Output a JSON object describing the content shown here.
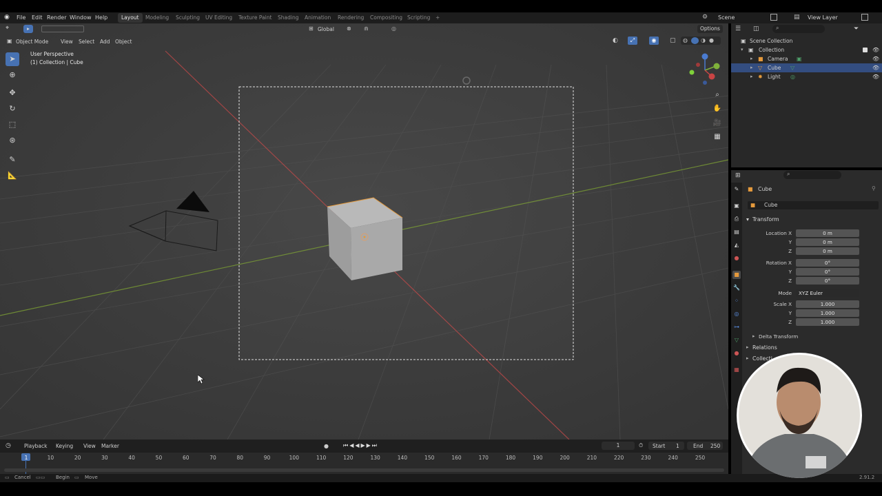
{
  "menu": {
    "items": [
      "File",
      "Edit",
      "Render",
      "Window",
      "Help"
    ],
    "workspaces": [
      "Layout",
      "Modeling",
      "Sculpting",
      "UV Editing",
      "Texture Paint",
      "Shading",
      "Animation",
      "Rendering",
      "Compositing",
      "Scripting"
    ],
    "active_workspace": "Layout",
    "scene": "Scene",
    "view_layer": "View Layer",
    "add_tab": "+"
  },
  "viewport": {
    "mode": "Object Mode",
    "menus": [
      "View",
      "Select",
      "Add",
      "Object"
    ],
    "transform_orientation": "Global",
    "options": "Options",
    "info_line1": "User Perspective",
    "info_line2": "(1) Collection | Cube"
  },
  "outliner": {
    "root": "Scene Collection",
    "collection": "Collection",
    "items": [
      "Camera",
      "Cube",
      "Light"
    ]
  },
  "properties": {
    "object_name": "Cube",
    "datablock_name": "Cube",
    "transform_header": "Transform",
    "location_label": "Location X",
    "rotation_label": "Rotation X",
    "scale_label": "Scale X",
    "y": "Y",
    "z": "Z",
    "location": [
      "0 m",
      "0 m",
      "0 m"
    ],
    "rotation": [
      "0°",
      "0°",
      "0°"
    ],
    "mode_label": "Mode",
    "mode_value": "XYZ Euler",
    "scale": [
      "1.000",
      "1.000",
      "1.000"
    ],
    "delta_transform": "Delta Transform",
    "relations": "Relations",
    "collections": "Collecti"
  },
  "timeline": {
    "menus": [
      "Playback",
      "Keying",
      "View",
      "Marker"
    ],
    "current_frame": "1",
    "start_label": "Start",
    "start": "1",
    "end_label": "End",
    "end": "250",
    "ticks": [
      "1",
      "10",
      "20",
      "30",
      "40",
      "50",
      "60",
      "70",
      "80",
      "90",
      "100",
      "110",
      "120",
      "130",
      "140",
      "150",
      "160",
      "170",
      "180",
      "190",
      "200",
      "210",
      "220",
      "230",
      "240",
      "250"
    ]
  },
  "statusbar": {
    "cancel": "Cancel",
    "begin": "Begin",
    "move": "Move",
    "version": "2.91.2"
  },
  "colors": {
    "accent": "#4772b3",
    "x_axis": "#b04a4a",
    "y_axis": "#7a9a3a",
    "selection_outline": "#e59a3c"
  }
}
